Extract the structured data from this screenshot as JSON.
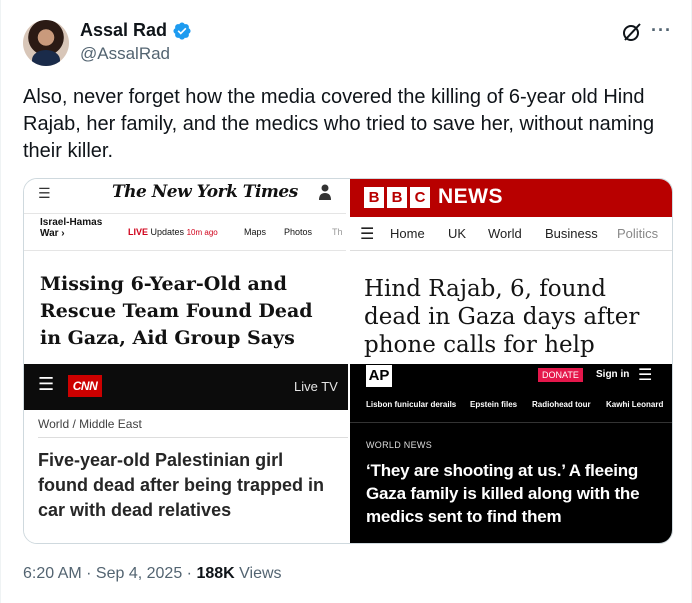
{
  "author": {
    "name": "Assal Rad",
    "handle": "@AssalRad",
    "verified_color": "#1d9bf0"
  },
  "tweet": {
    "text": "Also, never forget how the media covered the killing of 6-year old Hind Rajab, her family, and the medics who tried to save her, without naming their killer."
  },
  "media": {
    "nyt": {
      "logo": "The New York Times",
      "section": "Israel-Hamas War ›",
      "live_label": "LIVE",
      "live_text": "Updates",
      "live_time": "10m ago",
      "nav_maps": "Maps",
      "nav_photos": "Photos",
      "nav_more": "Th",
      "headline": "Missing 6-Year-Old and Rescue Team Found Dead in Gaza, Aid Group Says"
    },
    "bbc": {
      "blocks": [
        "B",
        "B",
        "C"
      ],
      "news": "NEWS",
      "nav": [
        "Home",
        "UK",
        "World",
        "Business",
        "Politics"
      ],
      "headline": "Hind Rajab, 6, found dead in Gaza days after phone calls for help",
      "brand_color": "#b80000"
    },
    "cnn": {
      "logo": "CNN",
      "live_tv": "Live TV",
      "section": "World / Middle East",
      "headline": "Five-year-old Palestinian girl found dead after being trapped in car with dead relatives",
      "brand_color": "#cc0000"
    },
    "ap": {
      "logo": "AP",
      "donate": "DONATE",
      "sign_in": "Sign in",
      "nav": [
        "Lisbon funicular derails",
        "Epstein files",
        "Radiohead tour",
        "Kawhi Leonard"
      ],
      "kicker": "WORLD NEWS",
      "headline": "‘They are shooting at us.’ A fleeing Gaza family is killed along with the medics sent to find them",
      "donate_color": "#e5174b"
    }
  },
  "meta": {
    "time": "6:20 AM · Sep 4, 2025 · ",
    "views_count": "188K",
    "views_label": " Views"
  },
  "icons": {
    "verified": "verified-badge-icon",
    "grok": "grok-icon",
    "more": "more-icon"
  }
}
